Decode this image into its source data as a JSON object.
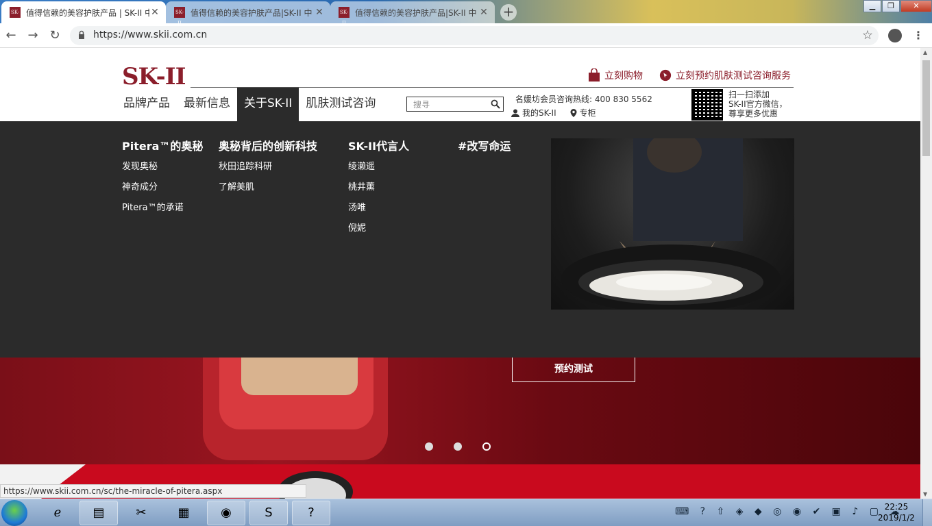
{
  "browser": {
    "tabs": [
      {
        "title": "值得信赖的美容护肤产品 | SK-II 中",
        "favicon": "SK-II",
        "active": true
      },
      {
        "title": "值得信赖的美容护肤产品|SK-II 中",
        "favicon": "SK-II",
        "active": false
      },
      {
        "title": "值得信赖的美容护肤产品|SK-II 中",
        "favicon": "SK-II",
        "active": false
      }
    ],
    "new_tab": "+",
    "url": "https://www.skii.com.cn",
    "status_url": "https://www.skii.com.cn/sc/the-miracle-of-pitera.aspx"
  },
  "site": {
    "logo": "SK-II",
    "brand_color": "#8b1e2b",
    "top_links": {
      "shop": "立刻购物",
      "booking": "立刻预约肌肤测试咨询服务"
    },
    "nav": [
      "品牌产品",
      "最新信息",
      "关于SK-II",
      "肌肤测试咨询"
    ],
    "active_nav": "关于SK-II",
    "search_placeholder": "搜寻",
    "hotline": "名媛坊会员咨询热线: 400 830 5562",
    "my_skii": "我的SK-II",
    "counter": "专柜",
    "wechat_text_1": "扫一扫添加",
    "wechat_text_2": "SK-II官方微信，",
    "wechat_text_3": "尊享更多优惠"
  },
  "mega_menu": {
    "columns": [
      {
        "heading": "Pitera™的奥秘",
        "links": [
          "发现奥秘",
          "神奇成分",
          "Pitera™的承诺"
        ]
      },
      {
        "heading": "奥秘背后的创新科技",
        "links": [
          "秋田追踪科研",
          "了解美肌"
        ]
      },
      {
        "heading": "SK-II代言人",
        "links": [
          "绫濑遥",
          "桃井薰",
          "汤唯",
          "倪妮"
        ]
      },
      {
        "heading": "#改写命运",
        "links": []
      }
    ]
  },
  "hero": {
    "cta": "预约测试",
    "slides": 3,
    "active_slide": 3
  },
  "taskbar": {
    "time": "22:25",
    "date": "2019/1/2"
  }
}
